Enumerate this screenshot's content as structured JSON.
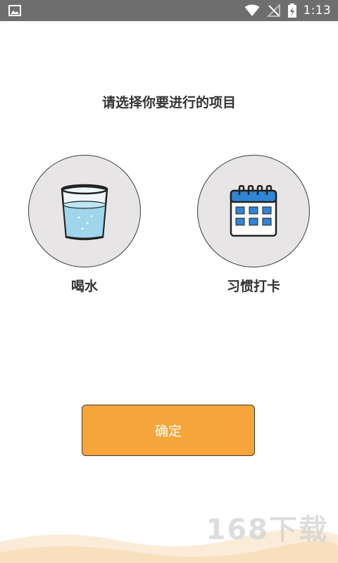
{
  "status_bar": {
    "time": "1:13",
    "icons": [
      "image-icon",
      "wifi-icon",
      "no-signal-icon",
      "battery-charging-icon"
    ]
  },
  "page": {
    "title": "请选择你要进行的项目"
  },
  "options": [
    {
      "label": "喝水",
      "icon": "water-glass-icon"
    },
    {
      "label": "习惯打卡",
      "icon": "calendar-icon"
    }
  ],
  "confirm_button": {
    "label": "确定"
  },
  "colors": {
    "accent": "#f5a53a",
    "circle_bg": "#e7e5e6",
    "status_bar": "#6e6e6e",
    "calendar_blue": "#2f86d4"
  },
  "watermark": {
    "text": "168下载"
  }
}
